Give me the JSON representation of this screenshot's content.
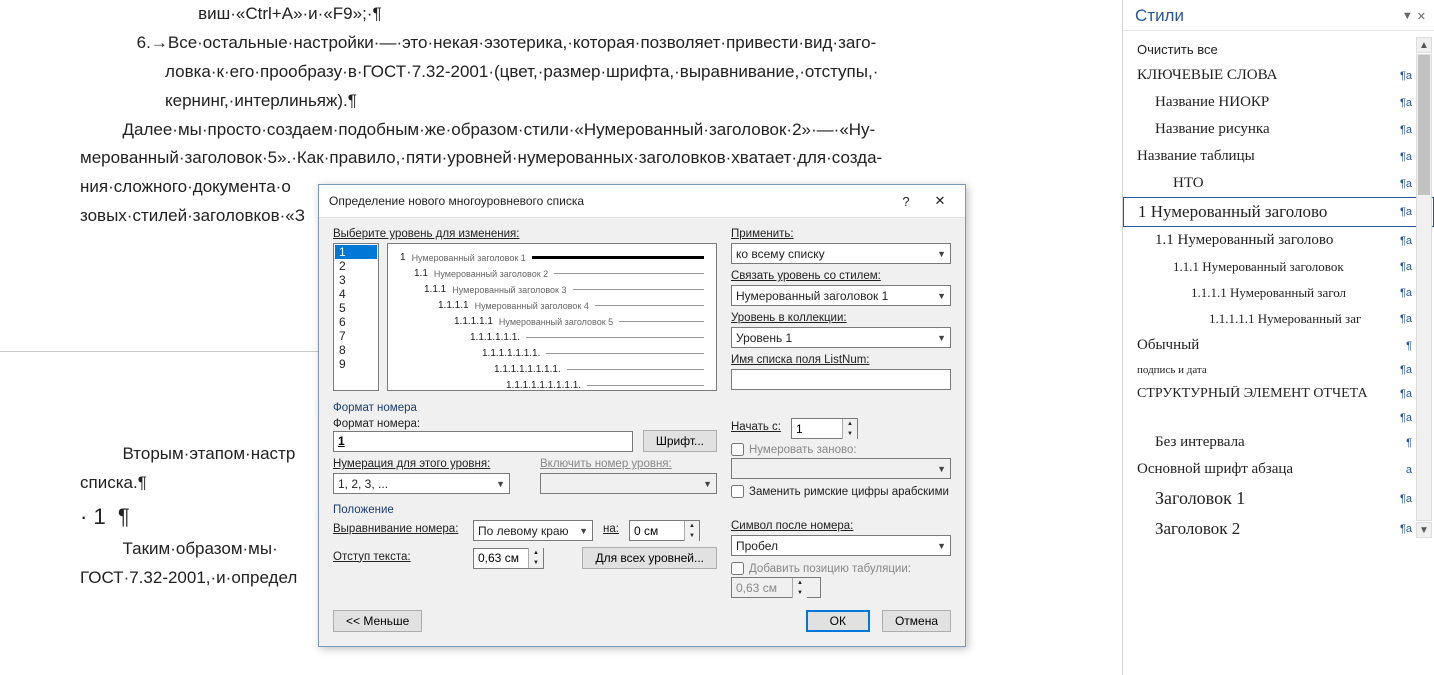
{
  "doc_lines_top": [
    "                         виш·«Ctrl+A»·и·«F9»;·¶",
    "            6.→Все·остальные·настройки·—·это·некая·эзотерика,·которая·позволяет·привести·вид·заго-",
    "                  ловка·к·его·прообразу·в·ГОСТ·7.32-2001·(цвет,·размер·шрифта,·выравнивание,·отступы,·",
    "                  кернинг,·интерлиньяж).¶",
    "         Далее·мы·просто·создаем·подобным·же·образом·стили·«Нумерованный·заголовок·2»·—·«Ну-",
    "мерованный·заголовок·5».·Как·правило,·пяти·уровней·нумерованных·заголовков·хватает·для·созда-",
    "ния·сложного·документа·о",
    "зовых·стилей·заголовков·«З"
  ],
  "doc_lines_bottom": [
    "         Вторым·этапом·настр",
    "списка.¶",
    "",
    "· 1  ¶",
    "",
    "         Таким·образом·мы·",
    "ГОСТ·7.32-2001,·и·определ"
  ],
  "styles": {
    "title": "Стили",
    "items": [
      {
        "label": "Очистить все",
        "mark": "",
        "lvl": 0
      },
      {
        "label": "КЛЮЧЕВЫЕ СЛОВА",
        "mark": "¶а",
        "lvl": 0,
        "font": "serif",
        "size": 15
      },
      {
        "label": "Название НИОКР",
        "mark": "¶a",
        "lvl": 1,
        "font": "serif",
        "size": 15
      },
      {
        "label": "Название рисунка",
        "mark": "¶a",
        "lvl": 1,
        "font": "serif",
        "size": 15
      },
      {
        "label": "Название таблицы",
        "mark": "¶a",
        "lvl": 0,
        "font": "serif",
        "size": 15
      },
      {
        "label": "НТО",
        "mark": "¶a",
        "lvl": 2,
        "font": "serif",
        "size": 15
      },
      {
        "label": "1  Нумерованный заголово",
        "mark": "¶а",
        "lvl": 0,
        "selected": true,
        "font": "serif",
        "size": 17
      },
      {
        "label": "1.1  Нумерованный заголово",
        "mark": "¶а",
        "lvl": 1,
        "font": "serif",
        "size": 15
      },
      {
        "label": "1.1.1  Нумерованный заголовок",
        "mark": "¶a",
        "lvl": 2,
        "font": "serif",
        "size": 13
      },
      {
        "label": "1.1.1.1  Нумерованный загол",
        "mark": "¶а",
        "lvl": 3,
        "font": "serif",
        "size": 13
      },
      {
        "label": "1.1.1.1.1  Нумерованный заг",
        "mark": "¶а",
        "lvl": 4,
        "font": "serif",
        "size": 13
      },
      {
        "label": "Обычный",
        "mark": "¶",
        "lvl": 0,
        "font": "serif",
        "size": 15
      },
      {
        "label": "подпись и дата",
        "mark": "¶a",
        "lvl": 0,
        "font": "serif",
        "size": 11
      },
      {
        "label": "СТРУКТУРНЫЙ ЭЛЕМЕНТ ОТЧЕТА",
        "mark": "¶а",
        "lvl": 0,
        "font": "serif",
        "size": 14
      },
      {
        "label": "",
        "mark": "¶a",
        "lvl": 1
      },
      {
        "label": "Без интервала",
        "mark": "¶",
        "lvl": 1,
        "font": "serif",
        "size": 15
      },
      {
        "label": "Основной шрифт абзаца",
        "mark": "а",
        "lvl": 0,
        "font": "serif",
        "size": 15
      },
      {
        "label": "Заголовок 1",
        "mark": "¶а",
        "lvl": 1,
        "font": "serif",
        "size": 18
      },
      {
        "label": "Заголовок 2",
        "mark": "¶а",
        "lvl": 1,
        "font": "serif",
        "size": 17
      }
    ]
  },
  "dialog": {
    "title": "Определение нового многоуровневого списка",
    "lbl_select_level": "Выберите уровень для изменения:",
    "levels": [
      "1",
      "2",
      "3",
      "4",
      "5",
      "6",
      "7",
      "8",
      "9"
    ],
    "preview_rows": [
      {
        "num": "1",
        "txt": "Нумерованный заголовок 1",
        "bold": true,
        "indent": 0
      },
      {
        "num": "1.1",
        "txt": "Нумерованный заголовок 2",
        "indent": 14
      },
      {
        "num": "1.1.1",
        "txt": "Нумерованный заголовок 3",
        "indent": 24
      },
      {
        "num": "1.1.1.1",
        "txt": "Нумерованный заголовок 4",
        "indent": 38
      },
      {
        "num": "1.1.1.1.1",
        "txt": "Нумерованный заголовок 5",
        "indent": 54
      },
      {
        "num": "1.1.1.1.1.1.",
        "txt": "",
        "indent": 70
      },
      {
        "num": "1.1.1.1.1.1.1.",
        "txt": "",
        "indent": 82
      },
      {
        "num": "1.1.1.1.1.1.1.1.",
        "txt": "",
        "indent": 94
      },
      {
        "num": "1.1.1.1.1.1.1.1.1.",
        "txt": "",
        "indent": 106
      }
    ],
    "lbl_apply": "Применить:",
    "apply_val": "ко всему списку",
    "lbl_link_style": "Связать уровень со стилем:",
    "link_style_val": "Нумерованный заголовок 1",
    "lbl_collection": "Уровень в коллекции:",
    "collection_val": "Уровень 1",
    "lbl_listnum": "Имя списка поля ListNum:",
    "listnum_val": "",
    "section_fmt": "Формат номера",
    "lbl_fmt_num": "Формат номера:",
    "fmt_num_val": "1",
    "btn_font": "Шрифт...",
    "lbl_numbering": "Нумерация для этого уровня:",
    "numbering_val": "1, 2, 3, ...",
    "lbl_include": "Включить номер уровня:",
    "include_val": "",
    "lbl_start": "Начать с:",
    "start_val": "1",
    "chk_renumber": "Нумеровать заново:",
    "renumber_val": "",
    "chk_roman": "Заменить римские цифры арабскими",
    "section_pos": "Положение",
    "lbl_align": "Выравнивание номера:",
    "align_val": "По левому краю",
    "lbl_at": "на:",
    "at_val": "0 см",
    "lbl_indent": "Отступ текста:",
    "indent_val": "0,63 см",
    "btn_all_levels": "Для всех уровней...",
    "lbl_symbol": "Символ после номера:",
    "symbol_val": "Пробел",
    "chk_tab": "Добавить позицию табуляции:",
    "tab_val": "0,63 см",
    "btn_less": "<< Меньше",
    "btn_ok": "ОК",
    "btn_cancel": "Отмена"
  }
}
